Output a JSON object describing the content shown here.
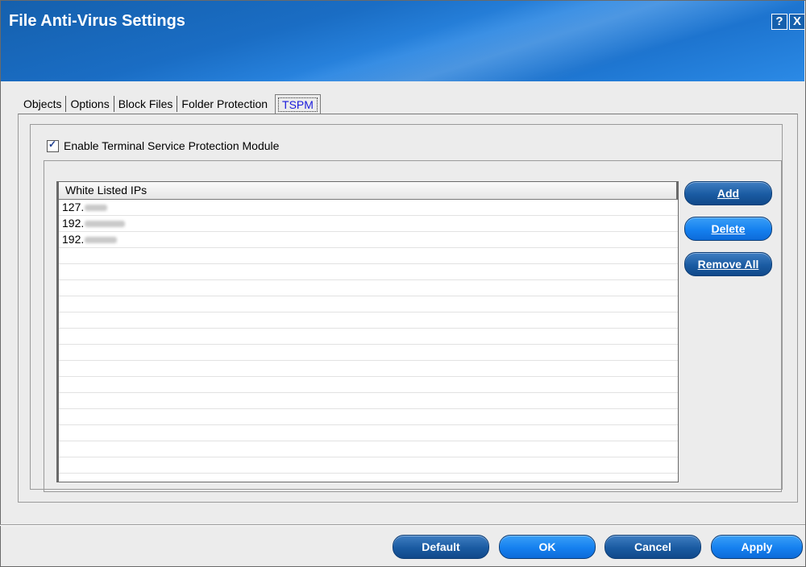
{
  "window": {
    "title": "File Anti-Virus Settings",
    "help_label": "?",
    "close_label": "X"
  },
  "tabs": [
    {
      "label": "Objects"
    },
    {
      "label": "Options"
    },
    {
      "label": "Block Files"
    },
    {
      "label": "Folder Protection"
    },
    {
      "label": "TSPM",
      "active": true
    }
  ],
  "tspm": {
    "enable_label": "Enable Terminal Service Protection Module",
    "enable_checked": true,
    "list_header": "White Listed IPs",
    "ips": [
      {
        "prefix": "127."
      },
      {
        "prefix": "192."
      },
      {
        "prefix": "192."
      }
    ],
    "add_label": "Add",
    "delete_label": "Delete",
    "remove_all_label": "Remove All"
  },
  "footer": {
    "default_label": "Default",
    "ok_label": "OK",
    "cancel_label": "Cancel",
    "apply_label": "Apply"
  },
  "colors": {
    "title_blue": "#1a6dc4",
    "button_dark": "#1a5ba2",
    "button_bright": "#1580ef"
  }
}
